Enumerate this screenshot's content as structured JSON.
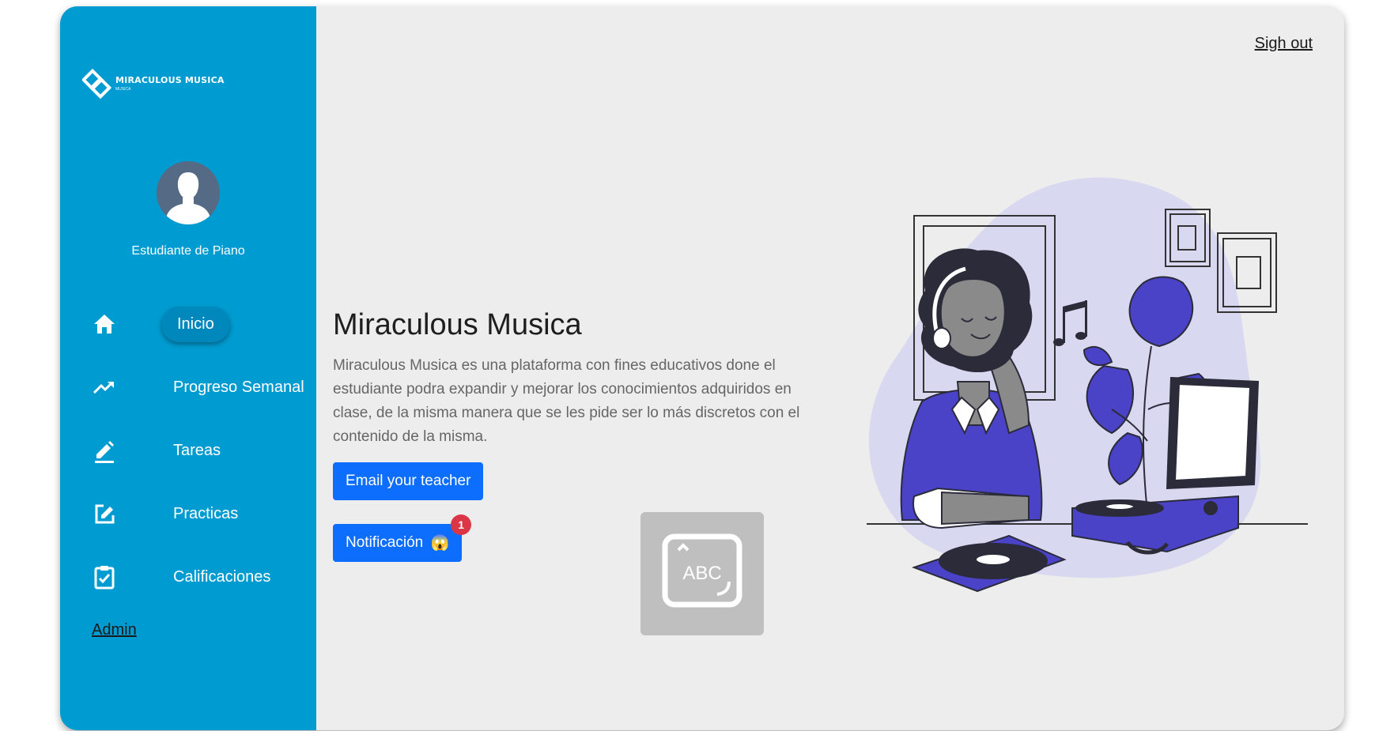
{
  "brand": {
    "title": "MIRACULOUS MUSICA",
    "subtitle": "MUSICA"
  },
  "user": {
    "name": "Estudiante de Piano"
  },
  "nav": {
    "items": [
      {
        "label": "Inicio",
        "icon": "home-icon",
        "active": true
      },
      {
        "label": "Progreso Semanal",
        "icon": "trending-up-icon"
      },
      {
        "label": "Tareas",
        "icon": "edit-icon"
      },
      {
        "label": "Practicas",
        "icon": "edit-square-icon"
      },
      {
        "label": "Calificaciones",
        "icon": "assignment-check-icon"
      }
    ],
    "admin_label": "Admin"
  },
  "header": {
    "signout_label": "Sigh out"
  },
  "hero": {
    "title": "Miraculous Musica",
    "description": "Miraculous Musica es una plataforma con fines educativos done el estudiante podra expandir y mejorar los conocimientos adquiridos en clase, de la misma manera que se les pide ser lo más discretos con el contenido de la misma."
  },
  "actions": {
    "email_label": "Email your teacher",
    "notification_label": "Notificación",
    "notification_emoji": "😱",
    "notification_count": "1"
  },
  "keyboard_widget": {
    "text": "ABC"
  },
  "colors": {
    "sidebar": "#009bd0",
    "sidebar_active": "#0087bb",
    "background": "#ededed",
    "primary_button": "#0d6efd",
    "badge": "#dc3545",
    "illustration_accent": "#4a43c8",
    "illustration_blob": "#d9d8f1"
  }
}
